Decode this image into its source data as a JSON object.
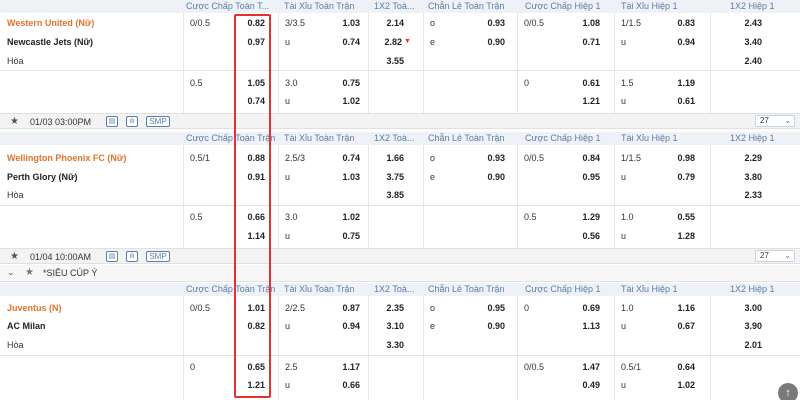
{
  "headers": {
    "col1": "Cược Chấp Toàn T...",
    "col1b": "Cược Chấp Toàn Trận",
    "col2": "Tài Xỉu Toàn Trận",
    "col3": "1X2 Toà...",
    "col4": "Chẵn Lẻ Toàn Trận",
    "col5": "Cược Chấp Hiệp 1",
    "col6": "Tài Xỉu Hiệp 1",
    "col7": "1X2 Hiệp 1"
  },
  "draw_label": "Hòa",
  "league": {
    "name": "*SIÊU CÚP Ý"
  },
  "matches": [
    {
      "home": "Western United (Nữ)",
      "away": "Newcastle Jets (Nữ)",
      "time": "01/03 03:00PM",
      "more_count": "27",
      "rows": [
        {
          "ah_line": "0/0.5",
          "ah_h": "0.82",
          "ah_a": "0.97",
          "ou_line": "3/3.5",
          "ou_o": "1.03",
          "ou_u_lbl": "u",
          "ou_u": "0.74",
          "x_h": "2.14",
          "x_a": "2.82",
          "x_d": "3.55",
          "oe_o_lbl": "o",
          "oe_o": "0.93",
          "oe_e_lbl": "e",
          "oe_e": "0.90",
          "h1_line": "0/0.5",
          "h1_h": "1.08",
          "h1_a": "0.71",
          "h1ou_line": "1/1.5",
          "h1ou_o": "0.83",
          "h1ou_u_lbl": "u",
          "h1ou_u": "0.94",
          "h1x_h": "2.43",
          "h1x_a": "3.40",
          "h1x_d": "2.40"
        },
        {
          "ah_line": "0.5",
          "ah_h": "1.05",
          "ah_a": "0.74",
          "ou_line": "3.0",
          "ou_o": "0.75",
          "ou_u_lbl": "u",
          "ou_u": "1.02",
          "h1_line": "0",
          "h1_h": "0.61",
          "h1_a": "1.21",
          "h1ou_line": "1.5",
          "h1ou_o": "1.19",
          "h1ou_u_lbl": "u",
          "h1ou_u": "0.61"
        }
      ]
    },
    {
      "home": "Wellington Phoenix FC (Nữ)",
      "away": "Perth Glory (Nữ)",
      "time": "01/04 10:00AM",
      "more_count": "27",
      "rows": [
        {
          "ah_line": "0.5/1",
          "ah_h": "0.88",
          "ah_a": "0.91",
          "ou_line": "2.5/3",
          "ou_o": "0.74",
          "ou_u_lbl": "u",
          "ou_u": "1.03",
          "x_h": "1.66",
          "x_a": "3.75",
          "x_d": "3.85",
          "oe_o_lbl": "o",
          "oe_o": "0.93",
          "oe_e_lbl": "e",
          "oe_e": "0.90",
          "h1_line": "0/0.5",
          "h1_h": "0.84",
          "h1_a": "0.95",
          "h1ou_line": "1/1.5",
          "h1ou_o": "0.98",
          "h1ou_u_lbl": "u",
          "h1ou_u": "0.79",
          "h1x_h": "2.29",
          "h1x_a": "3.80",
          "h1x_d": "2.33"
        },
        {
          "ah_line": "0.5",
          "ah_h": "0.66",
          "ah_a": "1.14",
          "ou_line": "3.0",
          "ou_o": "1.02",
          "ou_u_lbl": "u",
          "ou_u": "0.75",
          "h1_line": "0.5",
          "h1_h": "1.29",
          "h1_a": "0.56",
          "h1ou_line": "1.0",
          "h1ou_o": "0.55",
          "h1ou_u_lbl": "u",
          "h1ou_u": "1.28"
        }
      ]
    },
    {
      "home": "Juventus (N)",
      "away": "AC Milan",
      "rows": [
        {
          "ah_line": "0/0.5",
          "ah_h": "1.01",
          "ah_a": "0.82",
          "ou_line": "2/2.5",
          "ou_o": "0.87",
          "ou_u_lbl": "u",
          "ou_u": "0.94",
          "x_h": "2.35",
          "x_a": "3.10",
          "x_d": "3.30",
          "oe_o_lbl": "o",
          "oe_o": "0.95",
          "oe_e_lbl": "e",
          "oe_e": "0.90",
          "h1_line": "0",
          "h1_h": "0.69",
          "h1_a": "1.13",
          "h1ou_line": "1.0",
          "h1ou_o": "1.16",
          "h1ou_u_lbl": "u",
          "h1ou_u": "0.67",
          "h1x_h": "3.00",
          "h1x_a": "3.90",
          "h1x_d": "2.01"
        },
        {
          "ah_line": "0",
          "ah_h": "0.65",
          "ah_a": "1.21",
          "ou_line": "2.5",
          "ou_o": "1.17",
          "ou_u_lbl": "u",
          "ou_u": "0.66",
          "h1_line": "0/0.5",
          "h1_h": "1.47",
          "h1_a": "0.49",
          "h1ou_line": "0.5/1",
          "h1ou_o": "0.64",
          "h1ou_u_lbl": "u",
          "h1ou_u": "1.02"
        }
      ]
    }
  ],
  "controls": {
    "smp_label": "SMP"
  },
  "colors": {
    "highlight_box": "#e53030",
    "home_team": "#e0742b",
    "header_text": "#5a7dab"
  }
}
